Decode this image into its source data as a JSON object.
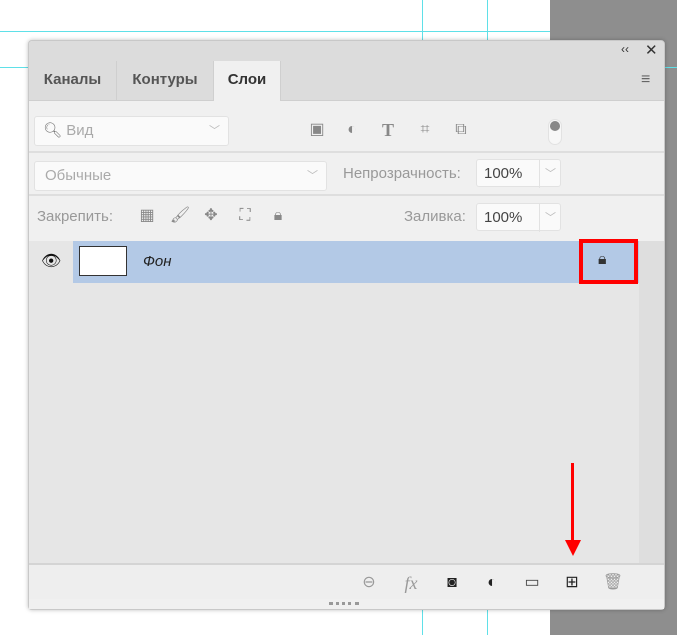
{
  "panel": {
    "collapse_icon": "double-chevron-left",
    "close_icon": "close",
    "tabs": [
      {
        "label": "Каналы"
      },
      {
        "label": "Контуры"
      },
      {
        "label": "Слои"
      }
    ],
    "active_tab": "Слои",
    "filter": {
      "placeholder": "Вид"
    },
    "blend_mode": "Обычные",
    "opacity_label": "Непрозрачность:",
    "opacity_value": "100%",
    "lock_label": "Закрепить:",
    "fill_label": "Заливка:",
    "fill_value": "100%",
    "layers": [
      {
        "name": "Фон",
        "visible": true,
        "locked": true
      }
    ]
  },
  "colors": {
    "highlight": "#ff0000",
    "selected_row": "#b3c9e6"
  }
}
